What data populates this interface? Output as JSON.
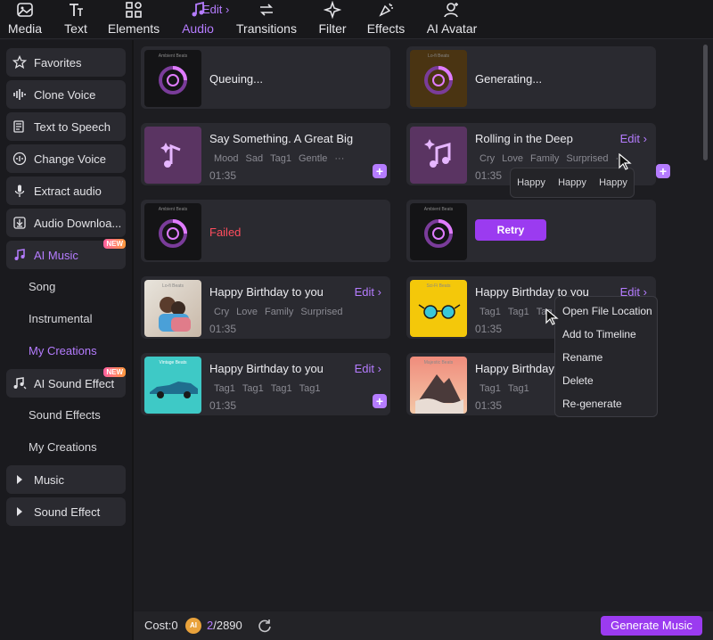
{
  "toolbar": {
    "tabs": [
      {
        "label": "Media",
        "icon": "media-icon"
      },
      {
        "label": "Text",
        "icon": "text-icon"
      },
      {
        "label": "Elements",
        "icon": "elements-icon"
      },
      {
        "label": "Audio",
        "icon": "audio-icon",
        "active": true
      },
      {
        "label": "Transitions",
        "icon": "transitions-icon"
      },
      {
        "label": "Filter",
        "icon": "filter-icon"
      },
      {
        "label": "Effects",
        "icon": "effects-icon"
      },
      {
        "label": "AI Avatar",
        "icon": "avatar-icon"
      }
    ],
    "audio_edit_label": "Edit"
  },
  "sidebar": {
    "items": [
      {
        "label": "Favorites",
        "icon": "star-icon"
      },
      {
        "label": "Clone Voice",
        "icon": "waveform-icon"
      },
      {
        "label": "Text to Speech",
        "icon": "text-to-speech-icon"
      },
      {
        "label": "Change Voice",
        "icon": "change-voice-icon"
      },
      {
        "label": "Extract audio",
        "icon": "microphone-icon"
      },
      {
        "label": "Audio Downloa...",
        "icon": "download-icon"
      },
      {
        "label": "AI Music",
        "icon": "music-note-icon",
        "badge": "NEW"
      },
      {
        "label": "AI Sound Effect",
        "icon": "sound-effect-icon",
        "badge": "NEW"
      },
      {
        "label": "Music",
        "icon": "caret-right-icon"
      },
      {
        "label": "Sound Effect",
        "icon": "caret-right-icon"
      }
    ],
    "ai_music_subs": [
      "Song",
      "Instrumental",
      "My Creations"
    ],
    "sound_effect_subs": [
      "Sound Effects",
      "My Creations"
    ]
  },
  "cards": {
    "c1": {
      "status": "Queuing...",
      "thumb_label": "Ambient Beats"
    },
    "c2": {
      "status": "Generating...",
      "thumb_label": "Lo-fi Beats"
    },
    "c3": {
      "title": "Say Something. A Great Big",
      "tags": [
        "Mood",
        "Sad",
        "Tag1",
        "Gentle",
        "···"
      ],
      "time": "01:35"
    },
    "c4": {
      "title": "Rolling in the Deep",
      "edit": "Edit",
      "tags": [
        "Cry",
        "Love",
        "Family",
        "Surprised",
        "···"
      ],
      "time": "01:35"
    },
    "c5": {
      "status": "Failed",
      "thumb_label": "Ambient Beats"
    },
    "c6": {
      "retry": "Retry",
      "thumb_label": "Ambient Beats"
    },
    "c7": {
      "title": "Happy Birthday to you",
      "edit": "Edit",
      "tags": [
        "Cry",
        "Love",
        "Family",
        "Surprised"
      ],
      "time": "01:35",
      "thumb_label": "Lo-fi Beats"
    },
    "c8": {
      "title": "Happy Birthday to you",
      "edit": "Edit",
      "tags": [
        "Tag1",
        "Tag1",
        "Tag"
      ],
      "time": "01:35",
      "thumb_label": "Sci-Fi Beats"
    },
    "c9": {
      "title": "Happy Birthday to you",
      "edit": "Edit",
      "tags": [
        "Tag1",
        "Tag1",
        "Tag1",
        "Tag1"
      ],
      "time": "01:35",
      "thumb_label": "Vintage Beats"
    },
    "c10": {
      "title": "Happy Birthday",
      "tags": [
        "Tag1",
        "Tag1"
      ],
      "time": "01:35",
      "thumb_label": "Majestic Beats"
    }
  },
  "tag_popup": [
    "Happy",
    "Happy",
    "Happy"
  ],
  "context_menu": [
    "Open File Location",
    "Add to Timeline",
    "Rename",
    "Delete",
    "Re-generate"
  ],
  "bottom": {
    "cost_label": "Cost:0",
    "coin_label": "AI",
    "credits_used": "2",
    "credits_total": "/2890",
    "generate_label": "Generate Music"
  },
  "colors": {
    "accent": "#b57cff",
    "button": "#9b3bf0",
    "failed": "#ff4d5e"
  }
}
